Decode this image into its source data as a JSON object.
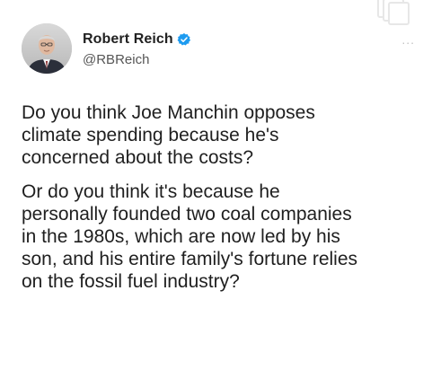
{
  "tweet": {
    "author": {
      "display_name": "Robert Reich",
      "handle": "@RBReich",
      "verified": true,
      "avatar_icon": "profile-photo"
    },
    "more_icon_label": "...",
    "paragraphs": [
      "Do you think Joe Manchin opposes\nclimate spending because he's\nconcerned about the costs?",
      "Or do you think it's because he\npersonally founded two coal companies\nin the 1980s, which are now led by his\nson, and his entire family's fortune relies\non the fossil fuel industry?"
    ]
  },
  "colors": {
    "verified_badge": "#1d9bf0",
    "text": "#1f1f1f",
    "handle": "#555555"
  }
}
